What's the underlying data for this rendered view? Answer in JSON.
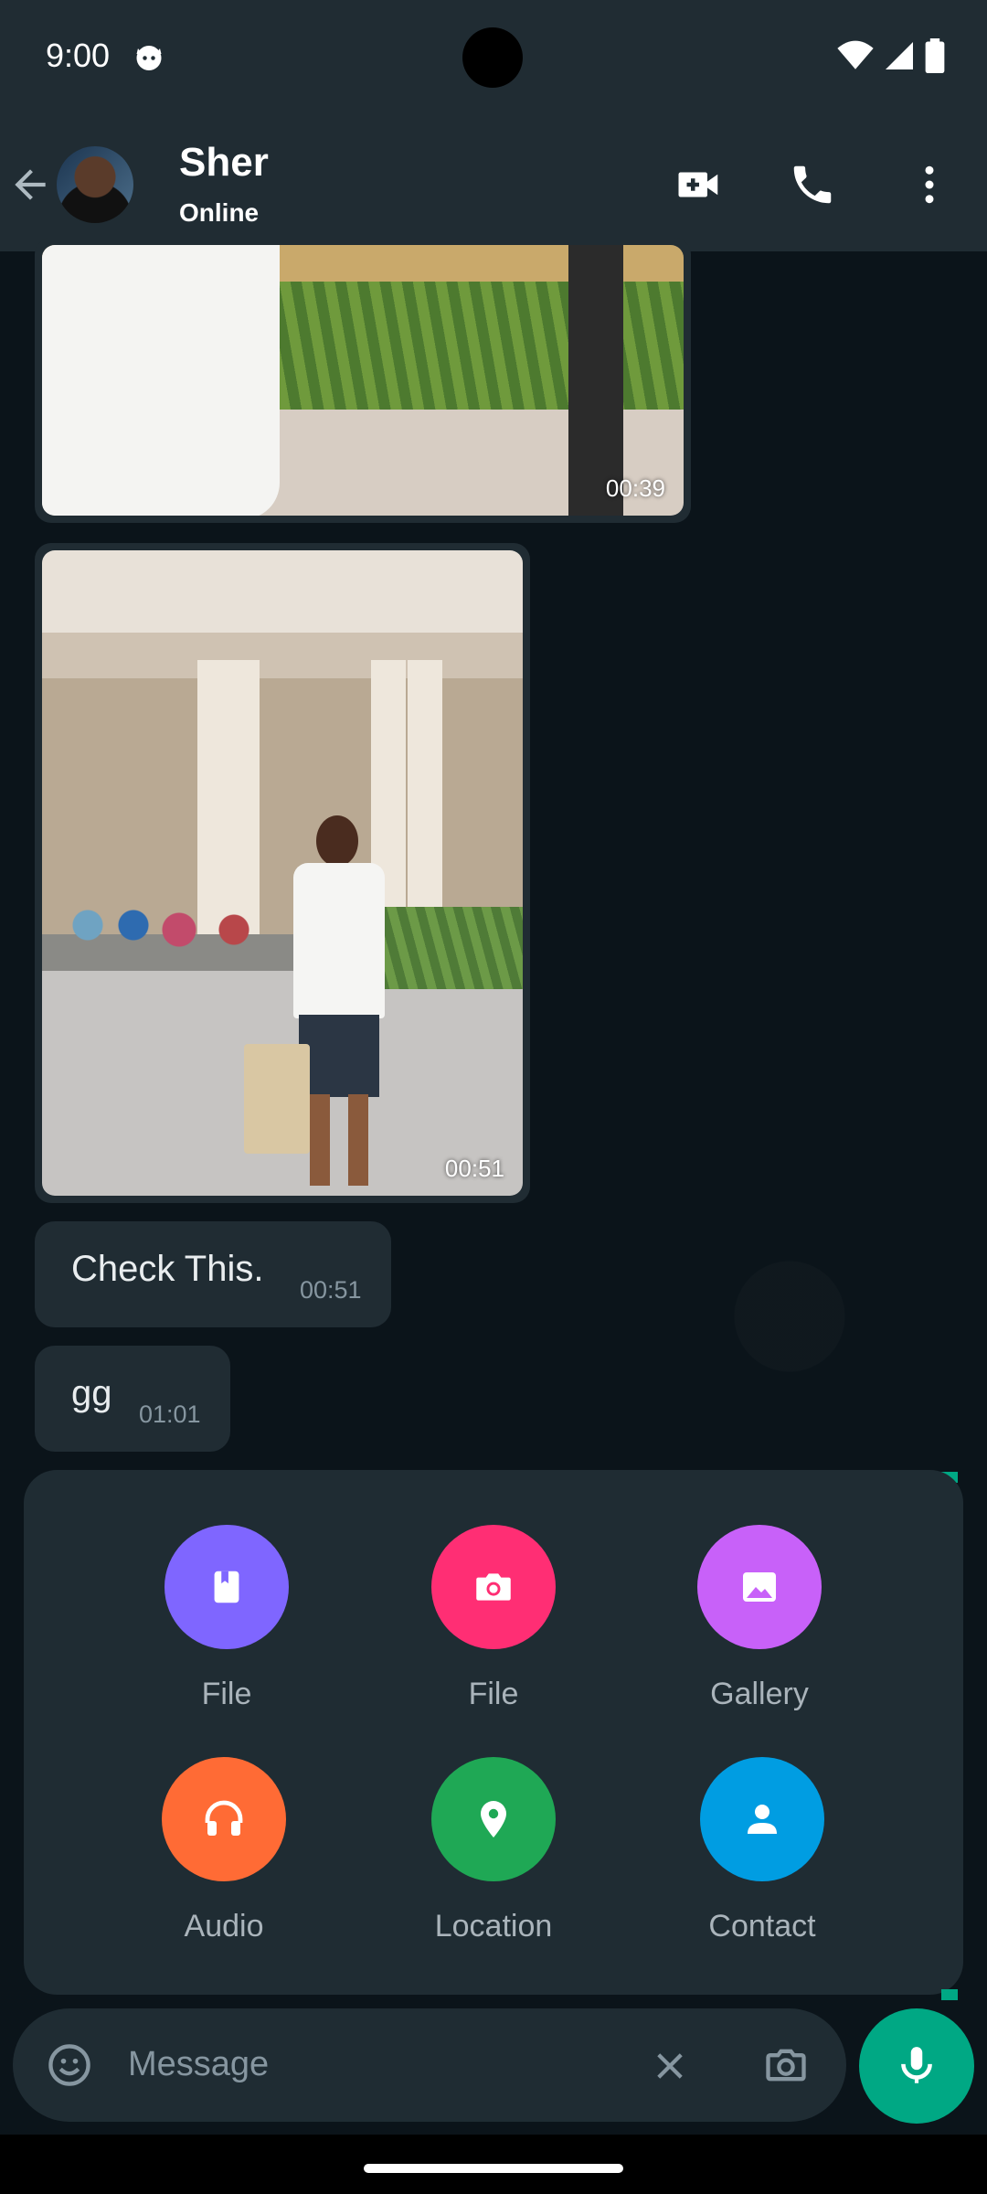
{
  "status_bar": {
    "time": "9:00"
  },
  "header": {
    "contact_name": "Sher",
    "contact_status": "Online"
  },
  "messages": {
    "video1_duration": "00:39",
    "video2_duration": "00:51",
    "text1": "Check This.",
    "text1_time": "00:51",
    "text2": "gg",
    "text2_time": "01:01"
  },
  "attachments": {
    "items": [
      {
        "label": "File",
        "icon": "document-icon",
        "color": "#7f66ff"
      },
      {
        "label": "File",
        "icon": "camera-icon",
        "color": "#ff2e74"
      },
      {
        "label": "Gallery",
        "icon": "image-icon",
        "color": "#c861f9"
      },
      {
        "label": "Audio",
        "icon": "headphones-icon",
        "color": "#ff6b35"
      },
      {
        "label": "Location",
        "icon": "location-pin-icon",
        "color": "#1fa855"
      },
      {
        "label": "Contact",
        "icon": "person-icon",
        "color": "#009de2"
      }
    ]
  },
  "composer": {
    "placeholder": "Message"
  },
  "colors": {
    "accent": "#00a884",
    "surface": "#202c33",
    "background": "#0b141a"
  }
}
